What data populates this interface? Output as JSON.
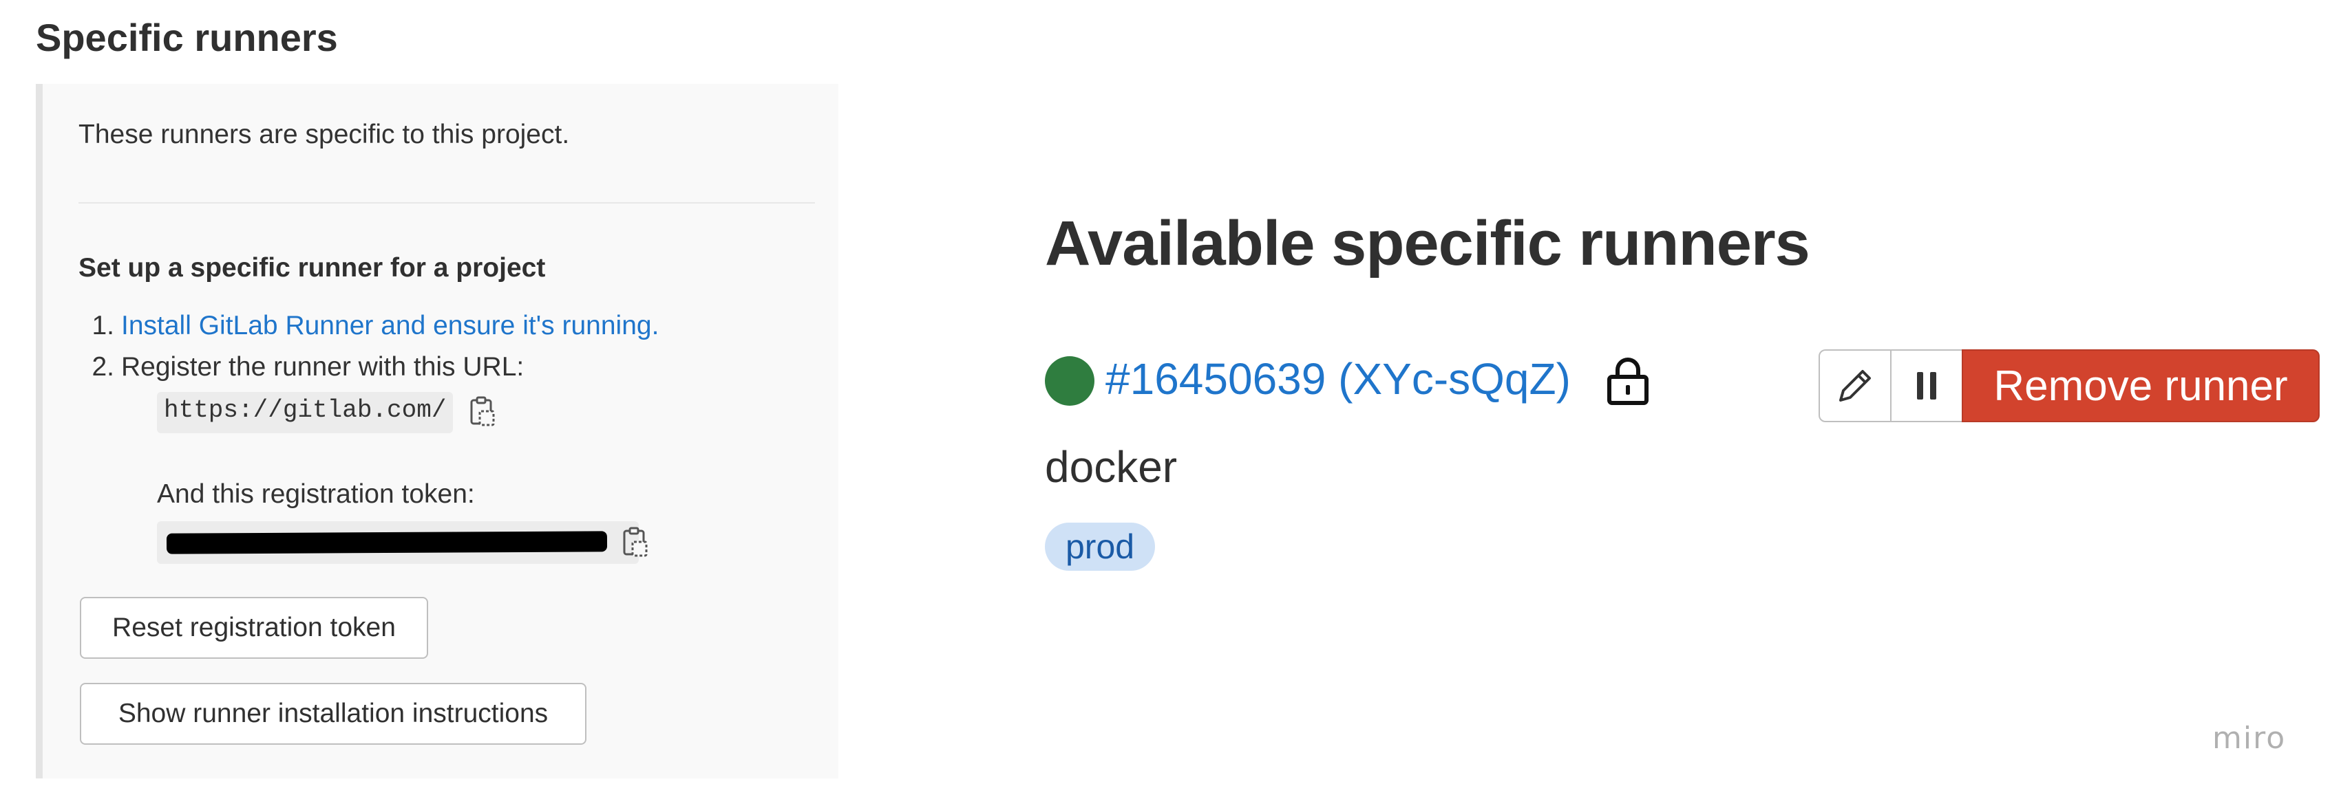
{
  "settings": {
    "title": "Specific runners",
    "description": "These runners are specific to this project.",
    "setup_title": "Set up a specific runner for a project",
    "steps": [
      {
        "number": "1.",
        "link_text": "Install GitLab Runner and ensure it's running."
      },
      {
        "number": "2.",
        "text": "Register the runner with this URL:"
      }
    ],
    "url_value": "https://gitlab.com/",
    "token_label": "And this registration token:",
    "reset_button_label": "Reset registration token",
    "show_instructions_button_label": "Show runner installation instructions",
    "icons": {
      "copy_url": "copy-icon",
      "copy_token": "copy-icon"
    }
  },
  "available": {
    "title": "Available specific runners",
    "runner": {
      "status_color": "#2f7d3f",
      "id_label": "#16450639 (XYc-sQqZ)",
      "description": "docker",
      "tags": [
        "prod"
      ],
      "locked_icon": "lock-icon"
    },
    "actions": {
      "edit_icon": "pencil-icon",
      "pause_icon": "pause-icon",
      "remove_label": "Remove runner"
    }
  },
  "watermark": "miro",
  "colors": {
    "link": "#1f75cb",
    "danger": "#d2432d",
    "tag_bg": "#cfe1f6"
  }
}
